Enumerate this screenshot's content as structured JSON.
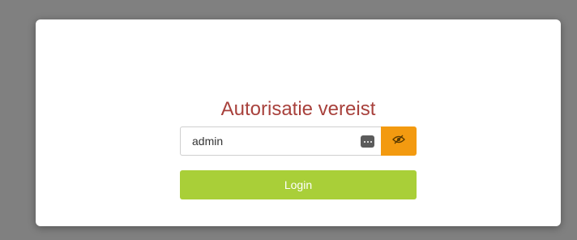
{
  "colors": {
    "page_background": "#808080",
    "card_background": "#ffffff",
    "title": "#a8413c",
    "toggle_button": "#f39a10",
    "login_button": "#a9cf38"
  },
  "auth": {
    "title": "Autorisatie vereist",
    "password_value": "admin",
    "password_manager_icon": "password-manager-icon",
    "toggle_icon": "eye-slash-icon",
    "login_label": "Login"
  }
}
